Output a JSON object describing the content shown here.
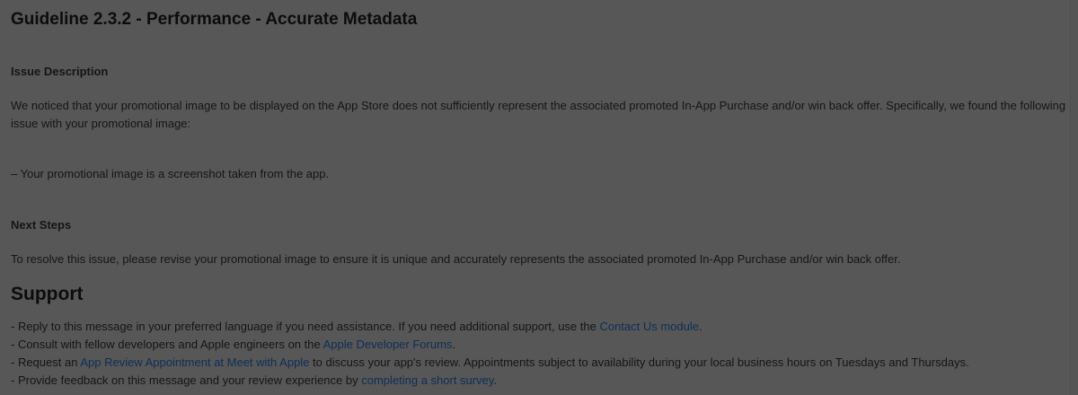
{
  "guideline": {
    "title": "Guideline 2.3.2 - Performance - Accurate Metadata"
  },
  "issue": {
    "heading": "Issue Description",
    "description": "We noticed that your promotional image to be displayed on the App Store does not sufficiently represent the associated promoted In-App Purchase and/or win back offer. Specifically, we found the following issue with your promotional image:",
    "bullet": "– Your promotional image is a screenshot taken from the app."
  },
  "next_steps": {
    "heading": "Next Steps",
    "text": "To resolve this issue, please revise your promotional image to ensure it is unique and accurately represents the associated promoted In-App Purchase and/or win back offer."
  },
  "support": {
    "title": "Support",
    "items": [
      {
        "before": "- Reply to this message in your preferred language if you need assistance. If you need additional support, use the ",
        "link": "Contact Us module",
        "after": "."
      },
      {
        "before": "- Consult with fellow developers and Apple engineers on the ",
        "link": "Apple Developer Forums",
        "after": "."
      },
      {
        "before": "- Request an ",
        "link": "App Review Appointment at Meet with Apple",
        "after": " to discuss your app's review. Appointments subject to availability during your local business hours on Tuesdays and Thursdays."
      },
      {
        "before": "- Provide feedback on this message and your review experience by ",
        "link": "completing a short survey",
        "after": "."
      }
    ]
  },
  "colors": {
    "overlay_background": "#575757",
    "text": "#151515",
    "link": "#0e2e57"
  }
}
